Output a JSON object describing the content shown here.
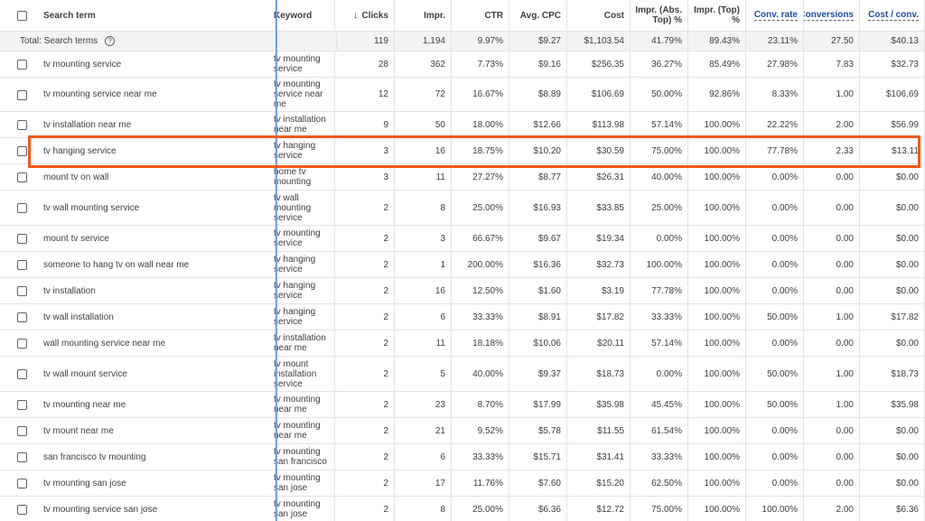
{
  "header": {
    "search_term": "Search term",
    "keyword": "Keyword",
    "clicks": "Clicks",
    "impr": "Impr.",
    "ctr": "CTR",
    "avg_cpc": "Avg. CPC",
    "cost": "Cost",
    "impr_abs_top": "Impr. (Abs. Top) %",
    "impr_top": "Impr. (Top) %",
    "conv_rate": "Conv. rate",
    "conversions": "Conversions",
    "cost_per_conv": "Cost / conv."
  },
  "total": {
    "label": "Total: Search terms",
    "clicks": "119",
    "impr": "1,194",
    "ctr": "9.97%",
    "avg_cpc": "$9.27",
    "cost": "$1,103.54",
    "impr_abs_top": "41.79%",
    "impr_top": "89.43%",
    "conv_rate": "23.11%",
    "conversions": "27.50",
    "cost_per_conv": "$40.13"
  },
  "rows": [
    {
      "term": "tv mounting service",
      "keyword": "tv mounting\nservice",
      "clicks": "28",
      "impr": "362",
      "ctr": "7.73%",
      "avg_cpc": "$9.16",
      "cost": "$256.35",
      "impr_abs_top": "36.27%",
      "impr_top": "85.49%",
      "conv_rate": "27.98%",
      "conversions": "7.83",
      "cost_per_conv": "$32.73"
    },
    {
      "term": "tv mounting service near me",
      "keyword": "tv mounting\nservice near\nme",
      "clicks": "12",
      "impr": "72",
      "ctr": "16.67%",
      "avg_cpc": "$8.89",
      "cost": "$106.69",
      "impr_abs_top": "50.00%",
      "impr_top": "92.86%",
      "conv_rate": "8.33%",
      "conversions": "1.00",
      "cost_per_conv": "$106.69"
    },
    {
      "term": "tv installation near me",
      "keyword": "tv installation\nnear me",
      "clicks": "9",
      "impr": "50",
      "ctr": "18.00%",
      "avg_cpc": "$12.66",
      "cost": "$113.98",
      "impr_abs_top": "57.14%",
      "impr_top": "100.00%",
      "conv_rate": "22.22%",
      "conversions": "2.00",
      "cost_per_conv": "$56.99"
    },
    {
      "term": "tv hanging service",
      "keyword": "tv hanging\nservice",
      "clicks": "3",
      "impr": "16",
      "ctr": "18.75%",
      "avg_cpc": "$10.20",
      "cost": "$30.59",
      "impr_abs_top": "75.00%",
      "impr_top": "100.00%",
      "conv_rate": "77.78%",
      "conversions": "2.33",
      "cost_per_conv": "$13.11"
    },
    {
      "term": "mount tv on wall",
      "keyword": "home tv\nmounting",
      "clicks": "3",
      "impr": "11",
      "ctr": "27.27%",
      "avg_cpc": "$8.77",
      "cost": "$26.31",
      "impr_abs_top": "40.00%",
      "impr_top": "100.00%",
      "conv_rate": "0.00%",
      "conversions": "0.00",
      "cost_per_conv": "$0.00"
    },
    {
      "term": "tv wall mounting service",
      "keyword": "tv wall\nmounting\nservice",
      "clicks": "2",
      "impr": "8",
      "ctr": "25.00%",
      "avg_cpc": "$16.93",
      "cost": "$33.85",
      "impr_abs_top": "25.00%",
      "impr_top": "100.00%",
      "conv_rate": "0.00%",
      "conversions": "0.00",
      "cost_per_conv": "$0.00"
    },
    {
      "term": "mount tv service",
      "keyword": "tv mounting\nservice",
      "clicks": "2",
      "impr": "3",
      "ctr": "66.67%",
      "avg_cpc": "$9.67",
      "cost": "$19.34",
      "impr_abs_top": "0.00%",
      "impr_top": "100.00%",
      "conv_rate": "0.00%",
      "conversions": "0.00",
      "cost_per_conv": "$0.00"
    },
    {
      "term": "someone to hang tv on wall near me",
      "keyword": "tv hanging\nservice",
      "clicks": "2",
      "impr": "1",
      "ctr": "200.00%",
      "avg_cpc": "$16.36",
      "cost": "$32.73",
      "impr_abs_top": "100.00%",
      "impr_top": "100.00%",
      "conv_rate": "0.00%",
      "conversions": "0.00",
      "cost_per_conv": "$0.00"
    },
    {
      "term": "tv installation",
      "keyword": "tv hanging\nservice",
      "clicks": "2",
      "impr": "16",
      "ctr": "12.50%",
      "avg_cpc": "$1.60",
      "cost": "$3.19",
      "impr_abs_top": "77.78%",
      "impr_top": "100.00%",
      "conv_rate": "0.00%",
      "conversions": "0.00",
      "cost_per_conv": "$0.00"
    },
    {
      "term": "tv wall installation",
      "keyword": "tv hanging\nservice",
      "clicks": "2",
      "impr": "6",
      "ctr": "33.33%",
      "avg_cpc": "$8.91",
      "cost": "$17.82",
      "impr_abs_top": "33.33%",
      "impr_top": "100.00%",
      "conv_rate": "50.00%",
      "conversions": "1.00",
      "cost_per_conv": "$17.82"
    },
    {
      "term": "wall mounting service near me",
      "keyword": "tv installation\nnear me",
      "clicks": "2",
      "impr": "11",
      "ctr": "18.18%",
      "avg_cpc": "$10.06",
      "cost": "$20.11",
      "impr_abs_top": "57.14%",
      "impr_top": "100.00%",
      "conv_rate": "0.00%",
      "conversions": "0.00",
      "cost_per_conv": "$0.00"
    },
    {
      "term": "tv wall mount service",
      "keyword": "tv mount\ninstallation\nservice",
      "clicks": "2",
      "impr": "5",
      "ctr": "40.00%",
      "avg_cpc": "$9.37",
      "cost": "$18.73",
      "impr_abs_top": "0.00%",
      "impr_top": "100.00%",
      "conv_rate": "50.00%",
      "conversions": "1.00",
      "cost_per_conv": "$18.73"
    },
    {
      "term": "tv mounting near me",
      "keyword": "tv mounting\nnear me",
      "clicks": "2",
      "impr": "23",
      "ctr": "8.70%",
      "avg_cpc": "$17.99",
      "cost": "$35.98",
      "impr_abs_top": "45.45%",
      "impr_top": "100.00%",
      "conv_rate": "50.00%",
      "conversions": "1.00",
      "cost_per_conv": "$35.98"
    },
    {
      "term": "tv mount near me",
      "keyword": "tv mounting\nnear me",
      "clicks": "2",
      "impr": "21",
      "ctr": "9.52%",
      "avg_cpc": "$5.78",
      "cost": "$11.55",
      "impr_abs_top": "61.54%",
      "impr_top": "100.00%",
      "conv_rate": "0.00%",
      "conversions": "0.00",
      "cost_per_conv": "$0.00"
    },
    {
      "term": "san francisco tv mounting",
      "keyword": "tv mounting\nsan francisco",
      "clicks": "2",
      "impr": "6",
      "ctr": "33.33%",
      "avg_cpc": "$15.71",
      "cost": "$31.41",
      "impr_abs_top": "33.33%",
      "impr_top": "100.00%",
      "conv_rate": "0.00%",
      "conversions": "0.00",
      "cost_per_conv": "$0.00"
    },
    {
      "term": "tv mounting san jose",
      "keyword": "tv mounting\nsan jose",
      "clicks": "2",
      "impr": "17",
      "ctr": "11.76%",
      "avg_cpc": "$7.60",
      "cost": "$15.20",
      "impr_abs_top": "62.50%",
      "impr_top": "100.00%",
      "conv_rate": "0.00%",
      "conversions": "0.00",
      "cost_per_conv": "$0.00"
    },
    {
      "term": "tv mounting service san jose",
      "keyword": "tv mounting\nsan jose",
      "clicks": "2",
      "impr": "8",
      "ctr": "25.00%",
      "avg_cpc": "$6.36",
      "cost": "$12.72",
      "impr_abs_top": "75.00%",
      "impr_top": "100.00%",
      "conv_rate": "100.00%",
      "conversions": "2.00",
      "cost_per_conv": "$6.36"
    }
  ]
}
